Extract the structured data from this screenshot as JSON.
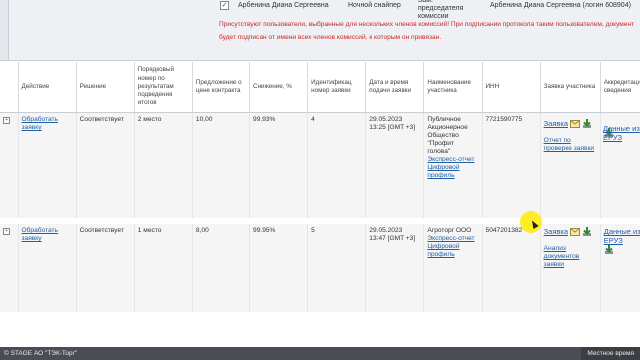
{
  "member": {
    "name": "Арбенина Диана Сергеевна",
    "role": "Ночной снайпер",
    "position": "Зам. председателя комиссии",
    "login": "Арбенина Диана Сергеевна (логин 608904)"
  },
  "warning": "Присутствуют пользователи, выбранные для нескольких членов комиссий! При подписании протокола таким пользователем, документ будет подписан от имени всех членов комиссий, к которым он привязан.",
  "columns": [
    "Действие",
    "Решение",
    "Порядковый номер по результатам подведения итогов",
    "Предложение о цене контракта",
    "Снижение, %",
    "Идентификац номер заявки",
    "Дата и время подачи заявки",
    "Наименование участника",
    "ИНН",
    "Заявка участника",
    "Аккредитация сведения"
  ],
  "rows": [
    {
      "action": "Обработать заявку",
      "decision": "Соответствует",
      "place": "2 место",
      "price": "10,00",
      "decrease": "99.93%",
      "id": "4",
      "date": "29.05.2023 13:25 [GMT +3]",
      "participant": "Публичное Акционерное Общество \"Профит голова\"",
      "express": "Экспресс-отчет Цифровой профиль",
      "inn": "7721590775",
      "app": "Заявка",
      "report": "Отчет по проверке заявки",
      "eruz": ""
    },
    {
      "action": "Обработать заявку",
      "decision": "Соответствует",
      "place": "1 место",
      "price": "8,00",
      "decrease": "99.95%",
      "id": "5",
      "date": "29.05.2023 13:47 [GMT +3]",
      "participant": "Агроторг ООО",
      "express": "Экспресс-отчет Цифровой профиль",
      "inn": "5047201382",
      "app": "Заявка",
      "report": "Анализ документов заявки",
      "eruz": "Данные из ЕРУЗ"
    }
  ],
  "row1_eruz": "Данные из ЕРУЗ",
  "footer": {
    "left": "© STAGE АО \"ТЭК-Торг\"",
    "right": "Местное время"
  }
}
